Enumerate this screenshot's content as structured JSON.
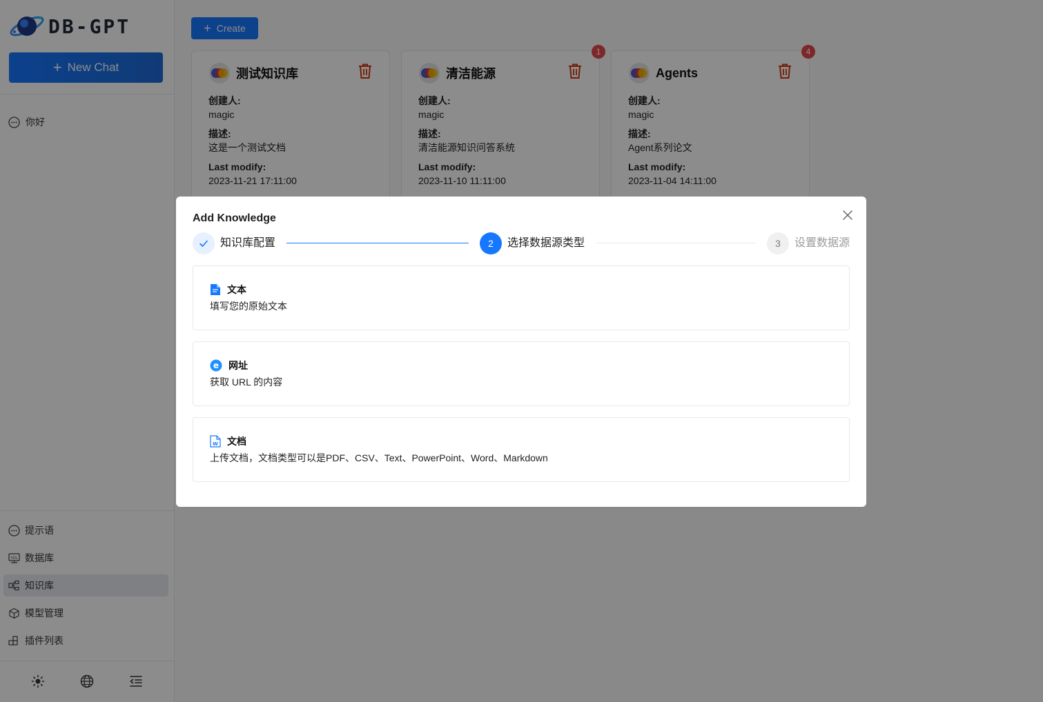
{
  "sidebar": {
    "logo_text": "DB-GPT",
    "new_chat_label": "New Chat",
    "chats": [
      {
        "label": "你好"
      }
    ],
    "menu": [
      {
        "label": "提示语",
        "icon": "message-icon"
      },
      {
        "label": "数据库",
        "icon": "database-icon"
      },
      {
        "label": "知识库",
        "icon": "knowledge-icon",
        "active": true
      },
      {
        "label": "模型管理",
        "icon": "model-cube-icon"
      },
      {
        "label": "插件列表",
        "icon": "plugin-icon"
      }
    ],
    "bottom_icons": [
      "sun-icon",
      "globe-icon",
      "collapse-menu-icon"
    ]
  },
  "main": {
    "create_label": "Create",
    "cards": [
      {
        "title": "测试知识库",
        "creator_label": "创建人:",
        "creator": "magic",
        "desc_label": "描述:",
        "desc": "这是一个测试文档",
        "modify_label": "Last modify:",
        "modified": "2023-11-21 17:11:00",
        "badge": ""
      },
      {
        "title": "清洁能源",
        "creator_label": "创建人:",
        "creator": "magic",
        "desc_label": "描述:",
        "desc": "清洁能源知识问答系统",
        "modify_label": "Last modify:",
        "modified": "2023-11-10 11:11:00",
        "badge": "1"
      },
      {
        "title": "Agents",
        "creator_label": "创建人:",
        "creator": "magic",
        "desc_label": "描述:",
        "desc": "Agent系列论文",
        "modify_label": "Last modify:",
        "modified": "2023-11-04 14:11:00",
        "badge": "4"
      }
    ]
  },
  "modal": {
    "title": "Add Knowledge",
    "steps": [
      {
        "label": "知识库配置",
        "state": "finished",
        "number": ""
      },
      {
        "label": "选择数据源类型",
        "state": "active",
        "number": "2"
      },
      {
        "label": "设置数据源",
        "state": "waiting",
        "number": "3"
      }
    ],
    "options": [
      {
        "title": "文本",
        "desc": "填写您的原始文本",
        "icon": "text-file-icon"
      },
      {
        "title": "网址",
        "desc": "获取 URL 的内容",
        "icon": "web-url-icon"
      },
      {
        "title": "文档",
        "desc": "上传文档，文档类型可以是PDF、CSV、Text、PowerPoint、Word、Markdown",
        "icon": "word-document-icon"
      }
    ]
  },
  "colors": {
    "primary": "#1677ff",
    "danger": "#d4380d",
    "badge": "#e5484d",
    "overlay": "rgba(0,0,0,0.45)"
  }
}
